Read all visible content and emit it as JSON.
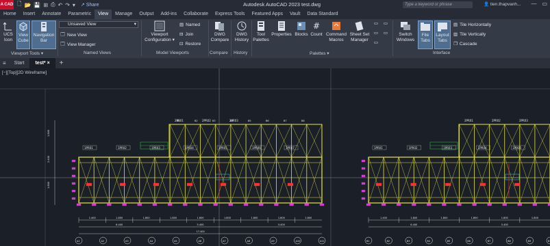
{
  "titlebar": {
    "logo": "A CAD",
    "share_label": "Share",
    "title": "Autodesk AutoCAD 2023    test.dwg",
    "search_placeholder": "Type a keyword or phrase",
    "user": "tien.thapvanh..."
  },
  "tabs": [
    "Home",
    "Insert",
    "Annotate",
    "Parametric",
    "View",
    "Manage",
    "Output",
    "Add-ins",
    "Collaborate",
    "Express Tools",
    "Featured Apps",
    "Vault",
    "Data Standard"
  ],
  "active_tab": "View",
  "ribbon": {
    "viewport_tools": {
      "ucs_icon": "UCS\nIcon",
      "view_cube": "View\nCube",
      "navigation_bar": "Navigation\nBar",
      "panel": "Viewport Tools ▾"
    },
    "named_views": {
      "dropdown": "Unsaved View",
      "new_view": "New View",
      "view_manager": "View Manager",
      "panel": "Named Views"
    },
    "model_viewports": {
      "viewport_configuration": "Viewport\nConfiguration ▾",
      "named": "Named",
      "join": "Join",
      "restore": "Restore",
      "panel": "Model Viewports"
    },
    "compare": {
      "dwg_compare": "DWG\nCompare",
      "panel": "Compare"
    },
    "history": {
      "dwg_history": "DWG\nHistory",
      "panel": "History"
    },
    "palettes": {
      "tool_palettes": "Tool\nPalettes",
      "properties": "Properties",
      "blocks": "Blocks",
      "count": "Count",
      "command_macros": "Command\nMacros",
      "sheet_set_manager": "Sheet Set\nManager",
      "panel": "Palettes ▾"
    },
    "interface": {
      "switch_windows": "Switch\nWindows",
      "file_tabs": "File\nTabs",
      "layout_tabs": "Layout\nTabs",
      "tile_horizontally": "Tile Horizontally",
      "tile_vertically": "Tile Vertically",
      "cascade": "Cascade",
      "panel": "Interface"
    }
  },
  "file_tabs": [
    "Start",
    "test*"
  ],
  "active_file_tab": "test*",
  "viewport_label": "[−][Top][2D Wireframe]",
  "drawing": {
    "left_rooms": [
      "1PR01",
      "1PR02",
      "1PR03",
      "1PR04",
      "1PR05",
      "1PR06",
      "1PR07"
    ],
    "left_upper": [
      "2PR01",
      "2PR02",
      "2PR03"
    ],
    "right_rooms": [
      "1PR01",
      "1PR02",
      "1PR03",
      "1PR04",
      "1PR05"
    ],
    "right_upper": [
      "2PR01",
      "2PR02",
      "2PR03"
    ],
    "left_dims_row1": [
      "1.400",
      "1.800",
      "1.800",
      "1.800",
      "1.800",
      "1.800",
      "1.800",
      "1.800",
      "1.800"
    ],
    "left_dims_row2": [
      "6.400",
      "5.400",
      "5.400"
    ],
    "left_total": "17.400",
    "right_dims_row1": [
      "1.400",
      "1.800",
      "1.800",
      "1.800",
      "1.800",
      "1.800"
    ],
    "right_dims_row2": [
      "6.400",
      "5.400"
    ],
    "grid_axes_left": [
      "A1",
      "A2",
      "A3",
      "A4",
      "A5",
      "A6",
      "A7",
      "A8",
      "A9",
      "A10",
      "A11"
    ],
    "grid_axes_right": [
      "B1",
      "B2",
      "B3",
      "B4",
      "B5",
      "B6",
      "B7",
      "B8",
      "B9",
      "B10"
    ],
    "vertical_dims_left": [
      "1.800",
      "2.400",
      "1.800"
    ],
    "top_marks": [
      "B1",
      "B2",
      "B3",
      "B4",
      "B5",
      "B6",
      "B7",
      "B8"
    ]
  },
  "colors": {
    "yellow": "#e8e83a",
    "magenta": "#d040d0",
    "cyan": "#3ad0ff",
    "red": "#ff3030",
    "green": "#30d040",
    "white": "#e8e8e8"
  }
}
